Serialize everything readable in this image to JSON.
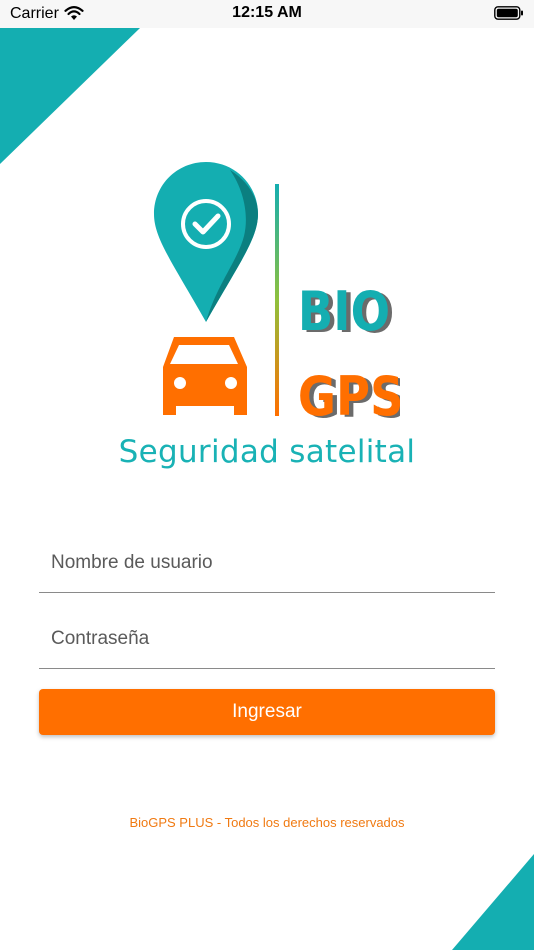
{
  "status_bar": {
    "carrier": "Carrier",
    "time": "12:15 AM"
  },
  "brand": {
    "line1": "BIO",
    "line2": "GPS",
    "tagline": "Seguridad satelital"
  },
  "login": {
    "username_placeholder": "Nombre de usuario",
    "password_placeholder": "Contraseña",
    "button_label": "Ingresar"
  },
  "footer": "BioGPS PLUS - Todos los derechos reservados",
  "colors": {
    "teal": "#14aeb1",
    "orange": "#ff6f00",
    "accent_text": "#19b2b5"
  },
  "icons": [
    "wifi-icon",
    "battery-icon",
    "map-pin-check-icon",
    "car-icon"
  ]
}
